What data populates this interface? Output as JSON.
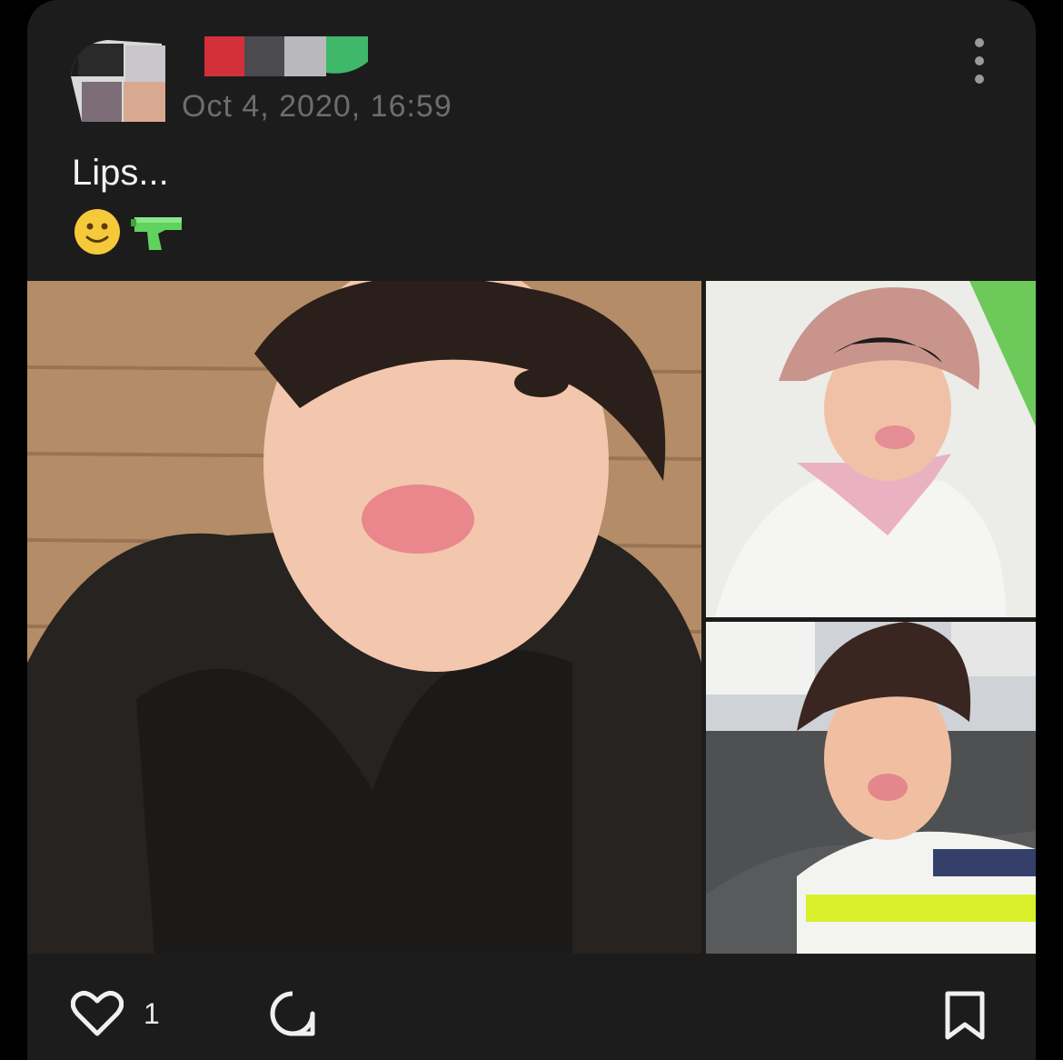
{
  "post": {
    "timestamp": "Oct 4, 2020, 16:59",
    "text": "Lips...",
    "emojis": [
      "🙂",
      "🔫"
    ],
    "like_count": "1"
  },
  "icons": {
    "more": "more-vertical-icon",
    "like": "heart-icon",
    "comment": "comment-bubble-icon",
    "save": "bookmark-icon"
  },
  "colors": {
    "card_bg": "#1c1c1c",
    "page_bg": "#000000",
    "timestamp": "#6d6d6d",
    "text": "#f2f2f2"
  }
}
